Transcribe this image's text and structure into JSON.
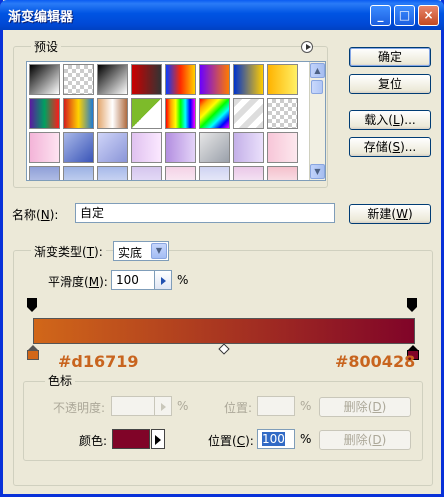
{
  "window": {
    "title": "渐变编辑器",
    "controls": {
      "minimize": "_",
      "maximize": "□",
      "close": "×"
    }
  },
  "presets": {
    "label": "预设",
    "menu_icon": "circle-arrow-icon",
    "swatches": [
      "linear-gradient(135deg,#000,#fff)",
      "repeating-conic-gradient(#ccc 0 25%, #fff 0 50%) 0 0/8px 8px",
      "linear-gradient(135deg,#000,#fff)",
      "linear-gradient(90deg,#c00,#333)",
      "linear-gradient(90deg,#0a3cff,#ff2a00,#ffd200)",
      "linear-gradient(90deg,#6a00ff,#ff7a00)",
      "linear-gradient(90deg,#0033cc,#ffcc00)",
      "linear-gradient(90deg,#ffb300,#fff066)",
      "linear-gradient(90deg,#5a1aa0,#00a060,#ff1a1a)",
      "linear-gradient(90deg,#d41d1d,#ffd200,#1d7ad4)",
      "linear-gradient(90deg,#e4a870,#fff,#b06c40)",
      "linear-gradient(135deg,#7dbb2a 50%,#fff 50%)",
      "linear-gradient(90deg,red,orange,yellow,lime,cyan,blue,magenta)",
      "linear-gradient(135deg,red,orange,yellow,lime,cyan,blue,magenta)",
      "repeating-linear-gradient(135deg,#ddd 0 6px,#fff 6px 12px)",
      "repeating-conic-gradient(#ccc 0 25%, #fff 0 50%) 0 0/8px 8px",
      "linear-gradient(90deg,#f3b4d8,#fde3f1)",
      "linear-gradient(135deg,#a9b8e8,#3a55b8)",
      "linear-gradient(135deg,#cfd4f8,#8a95d8)",
      "linear-gradient(90deg,#e0c2f0,#fbe8ff)",
      "linear-gradient(90deg,#b38ee0,#e4d4f8)",
      "linear-gradient(135deg,#e6e6e6,#9aa0aa)",
      "linear-gradient(90deg,#c4b0e8,#eae0fb)",
      "linear-gradient(90deg,#f7c6d8,#fde8ee)",
      "linear-gradient(180deg,#8fa0d8,#d6dcf4)",
      "linear-gradient(180deg,#9cb2e4,#e6ecfa)",
      "linear-gradient(180deg,#a7b9ea,#eef1fb)",
      "linear-gradient(180deg,#d5c6ee,#f3efff)",
      "linear-gradient(180deg,#f4d2e6,#fff)",
      "linear-gradient(180deg,#cfd3f2,#fff)",
      "linear-gradient(180deg,#eac8e8,#fff)",
      "linear-gradient(180deg,#f4c0cc,#fff)"
    ]
  },
  "buttons": {
    "ok": "确定",
    "reset": "复位",
    "load": "载入",
    "load_key": "L",
    "save": "存储",
    "save_key": "S",
    "new": "新建",
    "new_key": "W"
  },
  "name_field": {
    "label": "名称",
    "key": "N",
    "value": "自定"
  },
  "gradient": {
    "type_label": "渐变类型",
    "type_key": "T",
    "type_value": "实底",
    "smooth_label": "平滑度",
    "smooth_key": "M",
    "smooth_value": "100",
    "percent": "%",
    "start_color": "#d16719",
    "end_color": "#800428",
    "start_label": "#d16719",
    "end_label": "#800428"
  },
  "stops": {
    "group_label": "色标",
    "opacity_label": "不透明度",
    "opacity_value": "",
    "location_label": "位置",
    "location_value_top": "",
    "percent": "%",
    "delete_label": "删除",
    "delete_key": "D",
    "color_label": "颜色",
    "color_value": "#800428",
    "location_key": "C",
    "location_value": "100"
  },
  "colors": {
    "accent": "#c8641e"
  }
}
